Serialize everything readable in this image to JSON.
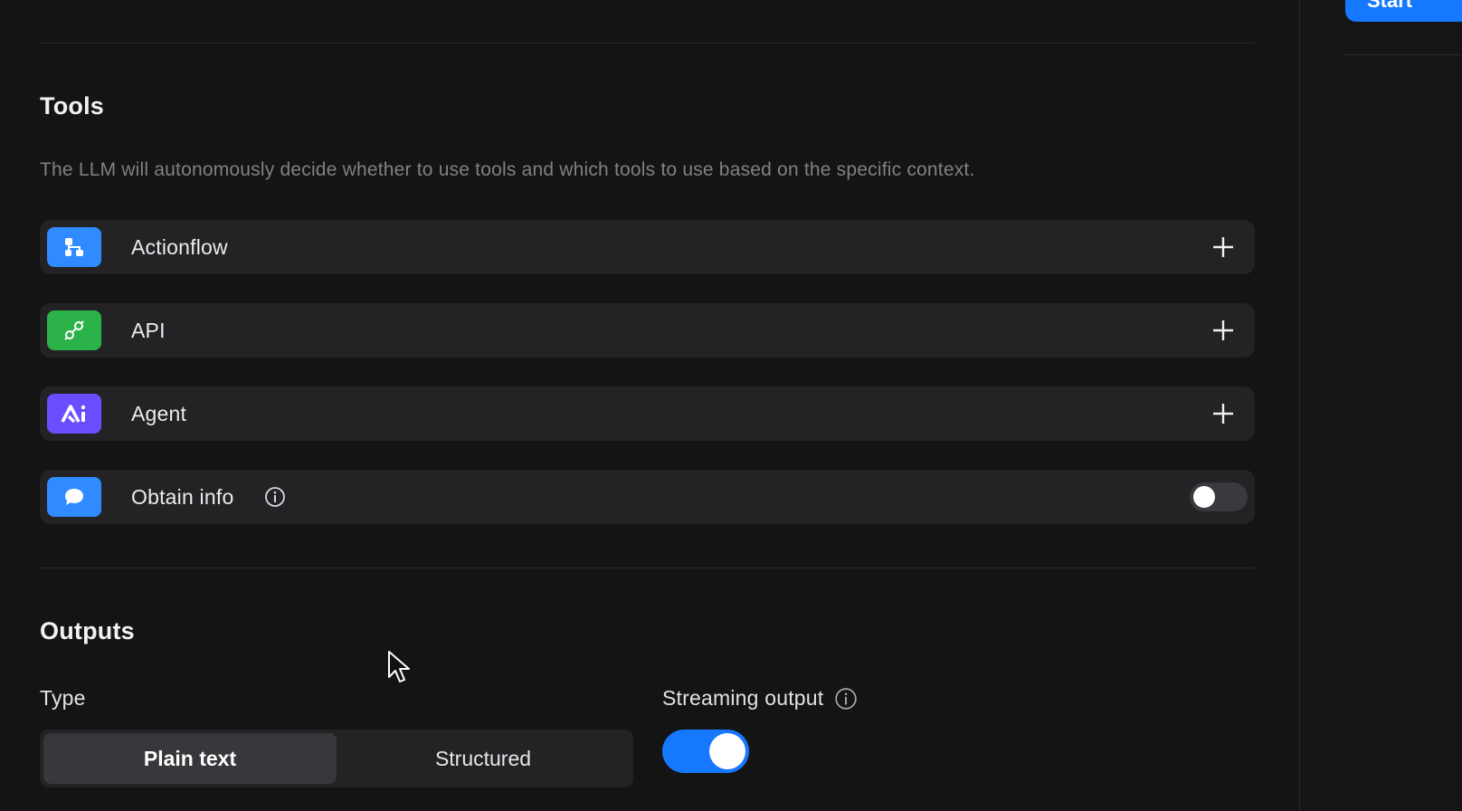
{
  "tools": {
    "title": "Tools",
    "description": "The LLM will autonomously decide whether to use tools and which tools to use based on the specific context.",
    "items": [
      {
        "label": "Actionflow",
        "icon": "actionflow-icon",
        "color": "#2f8bff",
        "action": "add"
      },
      {
        "label": "API",
        "icon": "api-icon",
        "color": "#2bb34a",
        "action": "add"
      },
      {
        "label": "Agent",
        "icon": "agent-icon",
        "color": "#6a4dff",
        "action": "add"
      },
      {
        "label": "Obtain info",
        "icon": "chat-bubble-icon",
        "color": "#2f8bff",
        "action": "toggle",
        "enabled": false
      }
    ]
  },
  "outputs": {
    "title": "Outputs",
    "type_label": "Type",
    "type_options": [
      "Plain text",
      "Structured"
    ],
    "type_selected": "Plain text",
    "streaming_label": "Streaming output",
    "streaming_enabled": true
  },
  "right_panel": {
    "button_label": "Start",
    "accent": "#1677ff"
  }
}
